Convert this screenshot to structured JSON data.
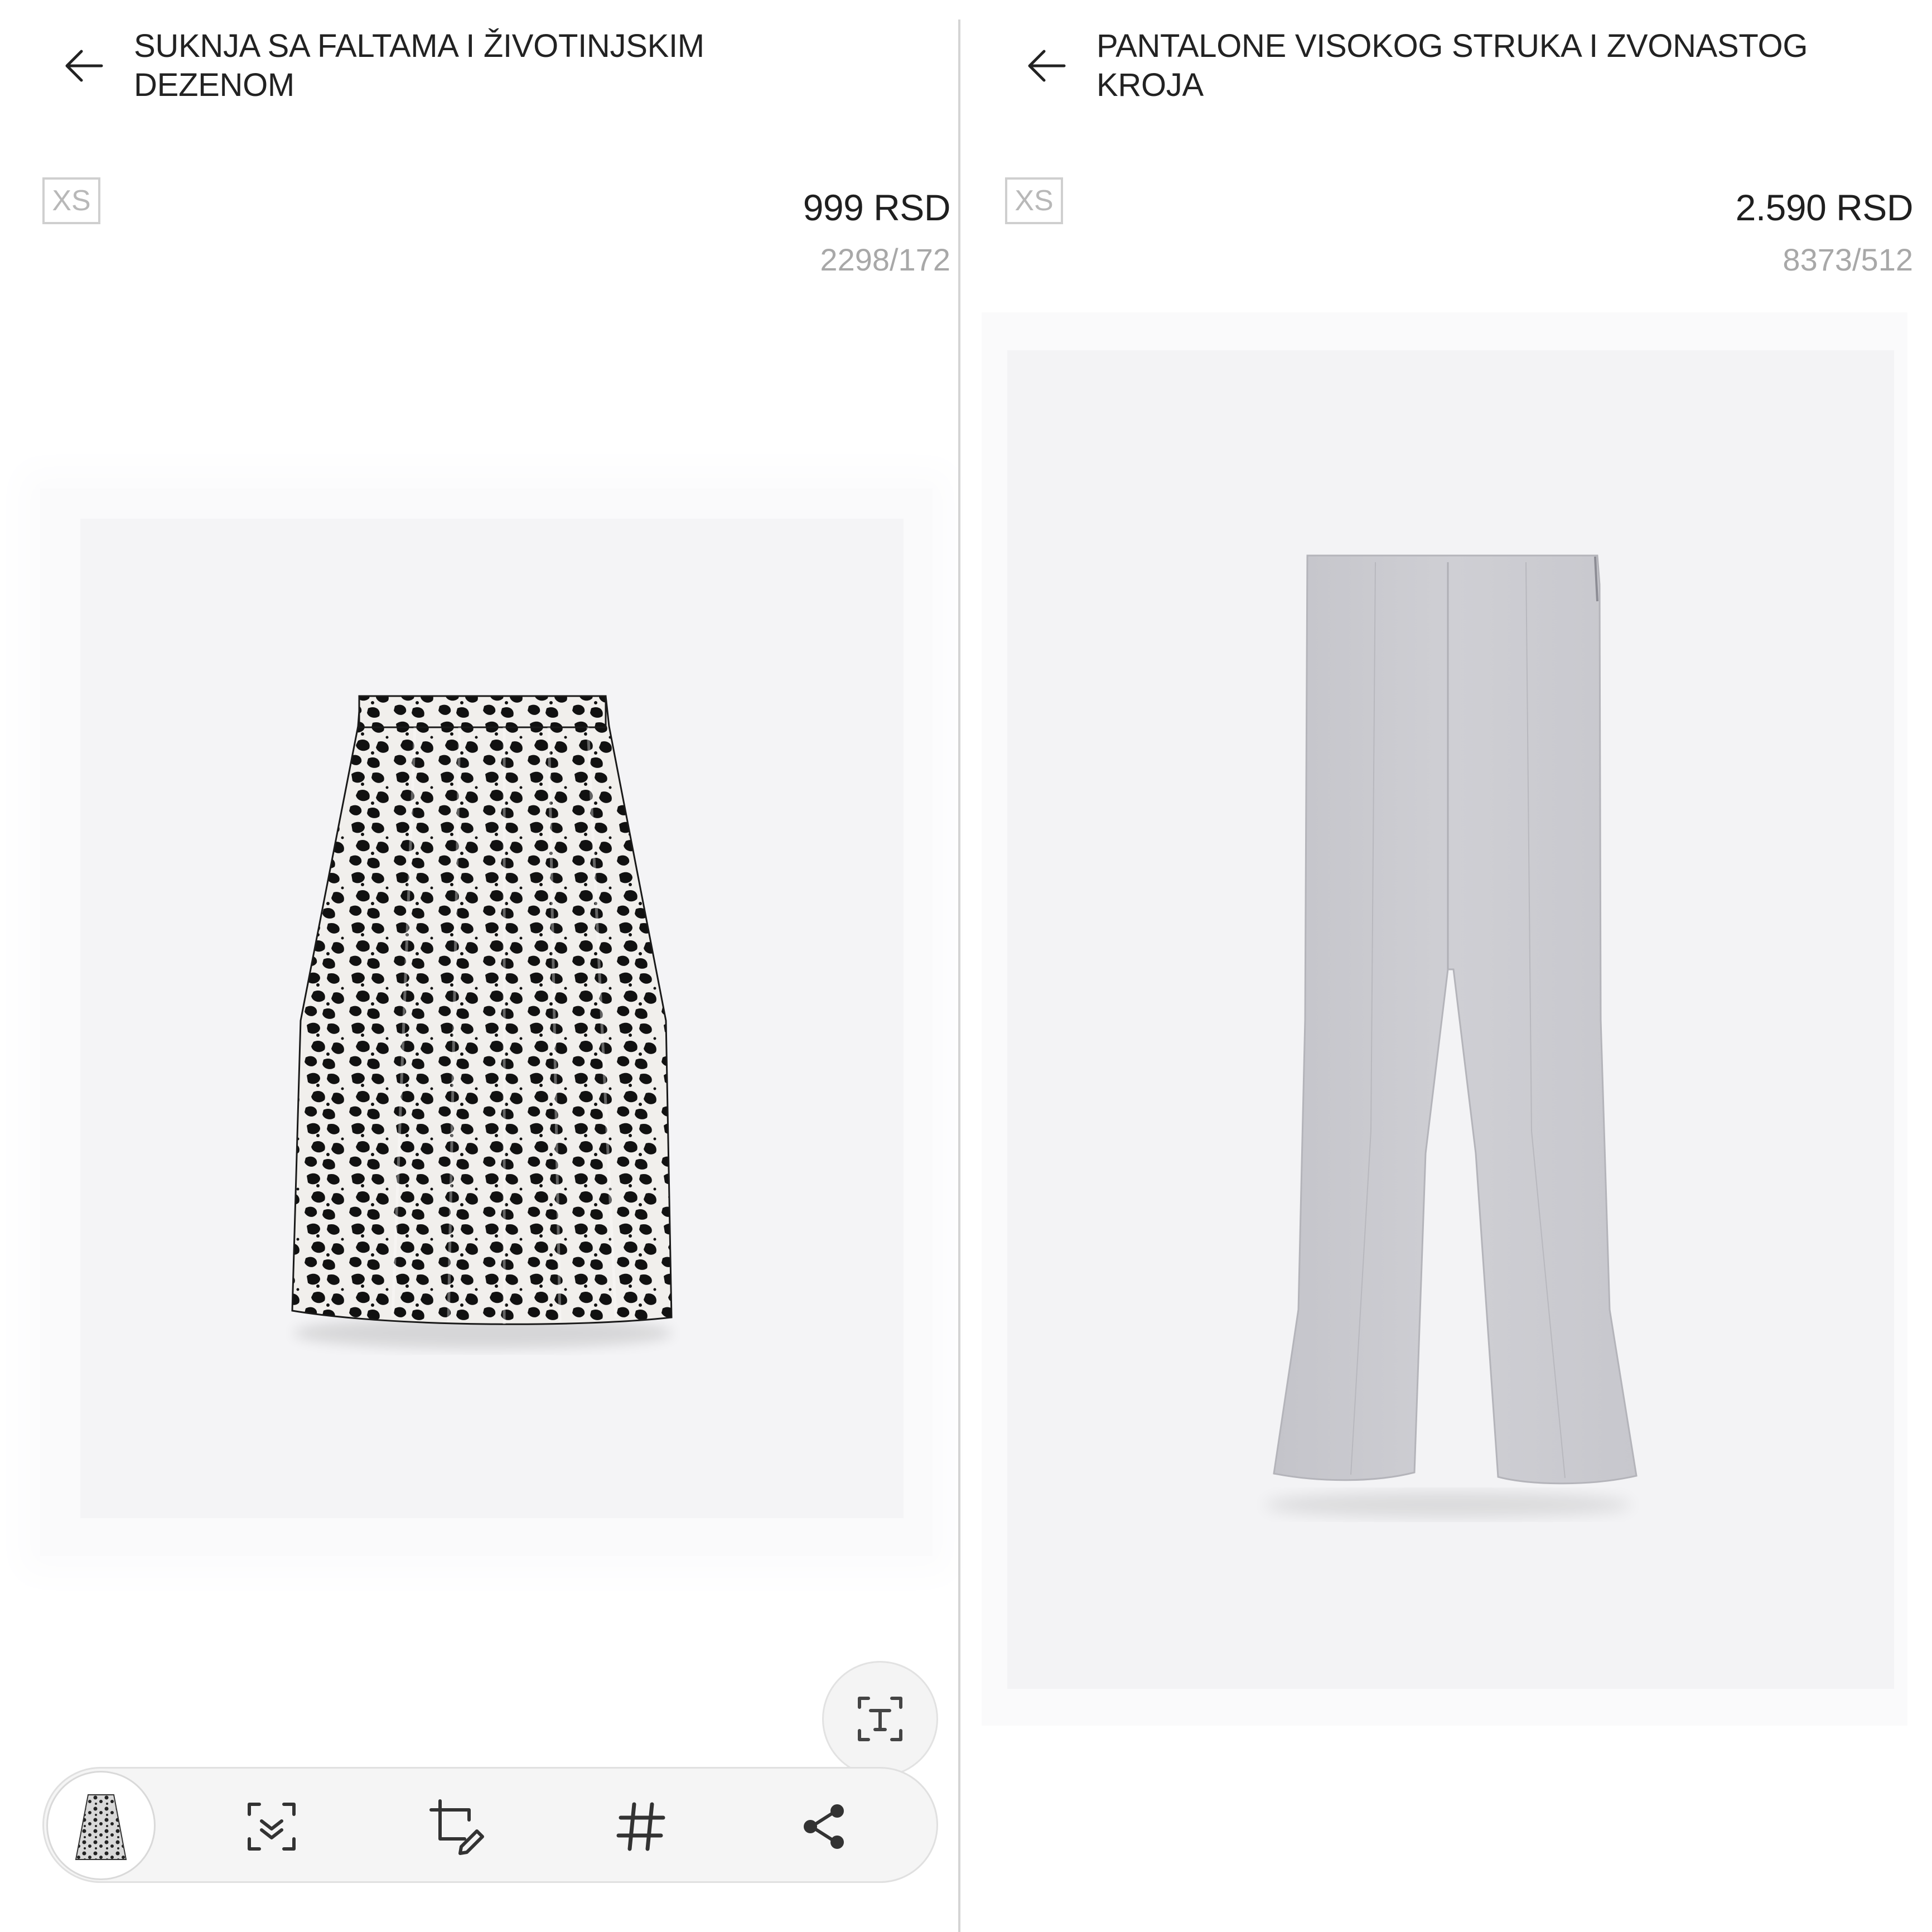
{
  "left_panel": {
    "title": "SUKNJA SA FALTAMA I ŽIVOTINJSKIM DEZENOM",
    "size": "XS",
    "price": "999 RSD",
    "sku": "2298/172",
    "product_image": "leopard-print-pleated-skirt"
  },
  "right_panel": {
    "title": "PANTALONE VISOKOG STRUKA I ZVONASTOG KROJA",
    "size": "XS",
    "price": "2.590 RSD",
    "sku": "8373/512",
    "product_image": "light-grey-flare-trousers"
  },
  "screenshot_tools": {
    "items": [
      {
        "icon": "thumbnail-preview"
      },
      {
        "icon": "scroll-capture-icon"
      },
      {
        "icon": "crop-edit-icon"
      },
      {
        "icon": "hashtag-icon"
      },
      {
        "icon": "share-icon"
      }
    ],
    "extract_text_icon": "extract-text-icon"
  },
  "colors": {
    "text": "#1f1f1f",
    "muted": "#a8a8a8",
    "background": "#ffffff",
    "product_bg": "#f4f4f6",
    "trousers": "#c9c9cf"
  }
}
